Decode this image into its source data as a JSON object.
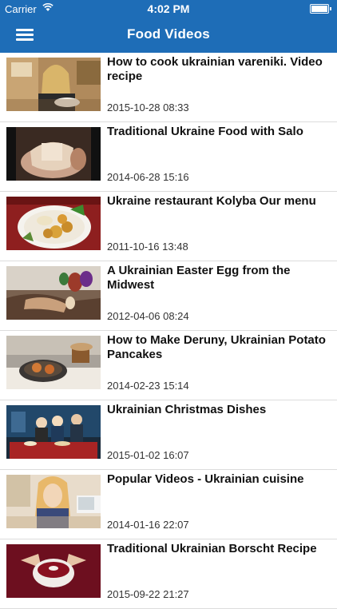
{
  "status_bar": {
    "carrier": "Carrier",
    "time": "4:02 PM"
  },
  "nav": {
    "title": "Food Videos",
    "menu_icon": "hamburger-menu-icon"
  },
  "colors": {
    "nav_background": "#1e6db7",
    "separator": "#dcdcdc"
  },
  "videos": [
    {
      "title": "How to cook ukrainian vareniki. Video recipe",
      "date": "2015-10-28 08:33"
    },
    {
      "title": "Traditional Ukraine Food with Salo",
      "date": "2014-06-28 15:16"
    },
    {
      "title": "Ukraine restaurant Kolyba Our menu",
      "date": "2011-10-16 13:48"
    },
    {
      "title": "A Ukrainian Easter Egg from the Midwest",
      "date": "2012-04-06 08:24"
    },
    {
      "title": "How to Make Deruny, Ukrainian Potato Pancakes",
      "date": "2014-02-23 15:14"
    },
    {
      "title": "Ukrainian Christmas Dishes",
      "date": "2015-01-02 16:07"
    },
    {
      "title": "Popular Videos - Ukrainian cuisine",
      "date": "2014-01-16 22:07"
    },
    {
      "title": "Traditional Ukrainian Borscht Recipe",
      "date": "2015-09-22 21:27"
    }
  ]
}
